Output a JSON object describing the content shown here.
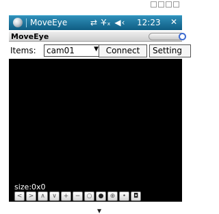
{
  "taskbar": {
    "title": "MoveEye",
    "status_icons": "⇄ Y̶ₓ ◀‹",
    "time": "12:23",
    "close": "✕"
  },
  "app": {
    "title": "MoveEye"
  },
  "toolbar": {
    "items_label": "Items:",
    "selected_item": "cam01",
    "connect_label": "Connect",
    "setting_label": "Setting"
  },
  "video": {
    "size_text": "size:0x0"
  },
  "controls": [
    {
      "name": "left-button",
      "glyph": "<"
    },
    {
      "name": "right-button",
      "glyph": ">"
    },
    {
      "name": "up-button",
      "glyph": "∧"
    },
    {
      "name": "down-button",
      "glyph": "∨"
    },
    {
      "name": "zoom-in-button",
      "glyph": "+"
    },
    {
      "name": "zoom-out-button",
      "glyph": "−"
    },
    {
      "name": "circle-button",
      "glyph": "○"
    },
    {
      "name": "record-button",
      "glyph": "●"
    },
    {
      "name": "target-button",
      "glyph": "⊕"
    },
    {
      "name": "point-button",
      "glyph": "•"
    },
    {
      "name": "camera-button",
      "glyph": "◘"
    }
  ],
  "icons": [
    "windows-start-icon",
    "sync-icon",
    "signal-icon",
    "volume-icon",
    "close-icon"
  ]
}
